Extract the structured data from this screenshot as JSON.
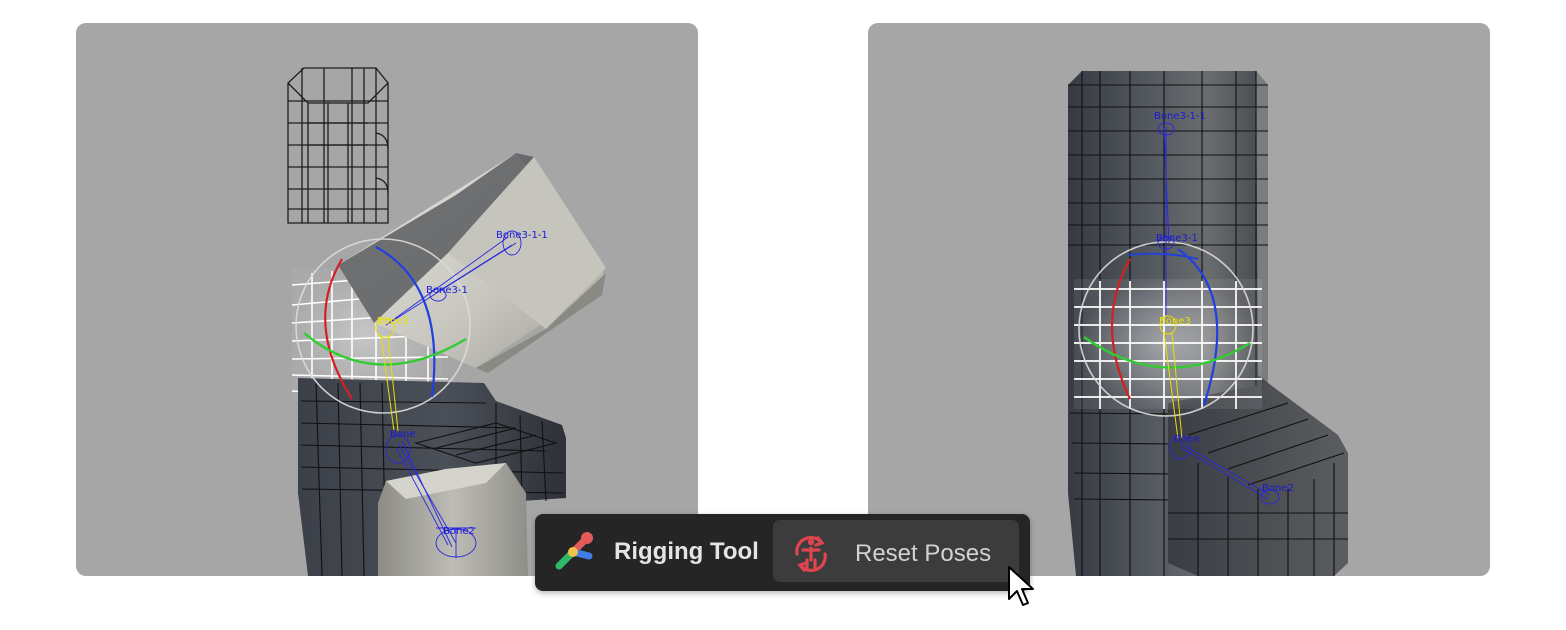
{
  "viewports": {
    "left": {
      "bones": {
        "bone3_1_1": "Bone3-1-1",
        "bone3_1": "Bone3-1",
        "bone3": "Bone3",
        "bone": "Bone",
        "bone2": "Bone2"
      }
    },
    "right": {
      "bones": {
        "bone3_1_1": "Bone3-1-1",
        "bone3_1": "Bone3-1",
        "bone3": "Bone3",
        "bone": "Bone",
        "bone2": "Bone2"
      }
    }
  },
  "toolbar": {
    "tool_icon": "wrench-icon",
    "title": "Rigging Tool",
    "reset_icon": "reset-pose-figure-icon",
    "reset_label": "Reset Poses"
  },
  "cursor": {
    "icon": "mouse-pointer-icon"
  },
  "colors": {
    "viewport_bg": "#a6a6a6",
    "toolbar_bg": "#252525",
    "button_bg": "#3c3c3c",
    "bone_label": "#1a1ad8",
    "selected_bone": "#e8e000",
    "gizmo_x": "#d42020",
    "gizmo_y": "#32cc32",
    "gizmo_z": "#2040e0",
    "reset_icon": "#e0454f"
  }
}
